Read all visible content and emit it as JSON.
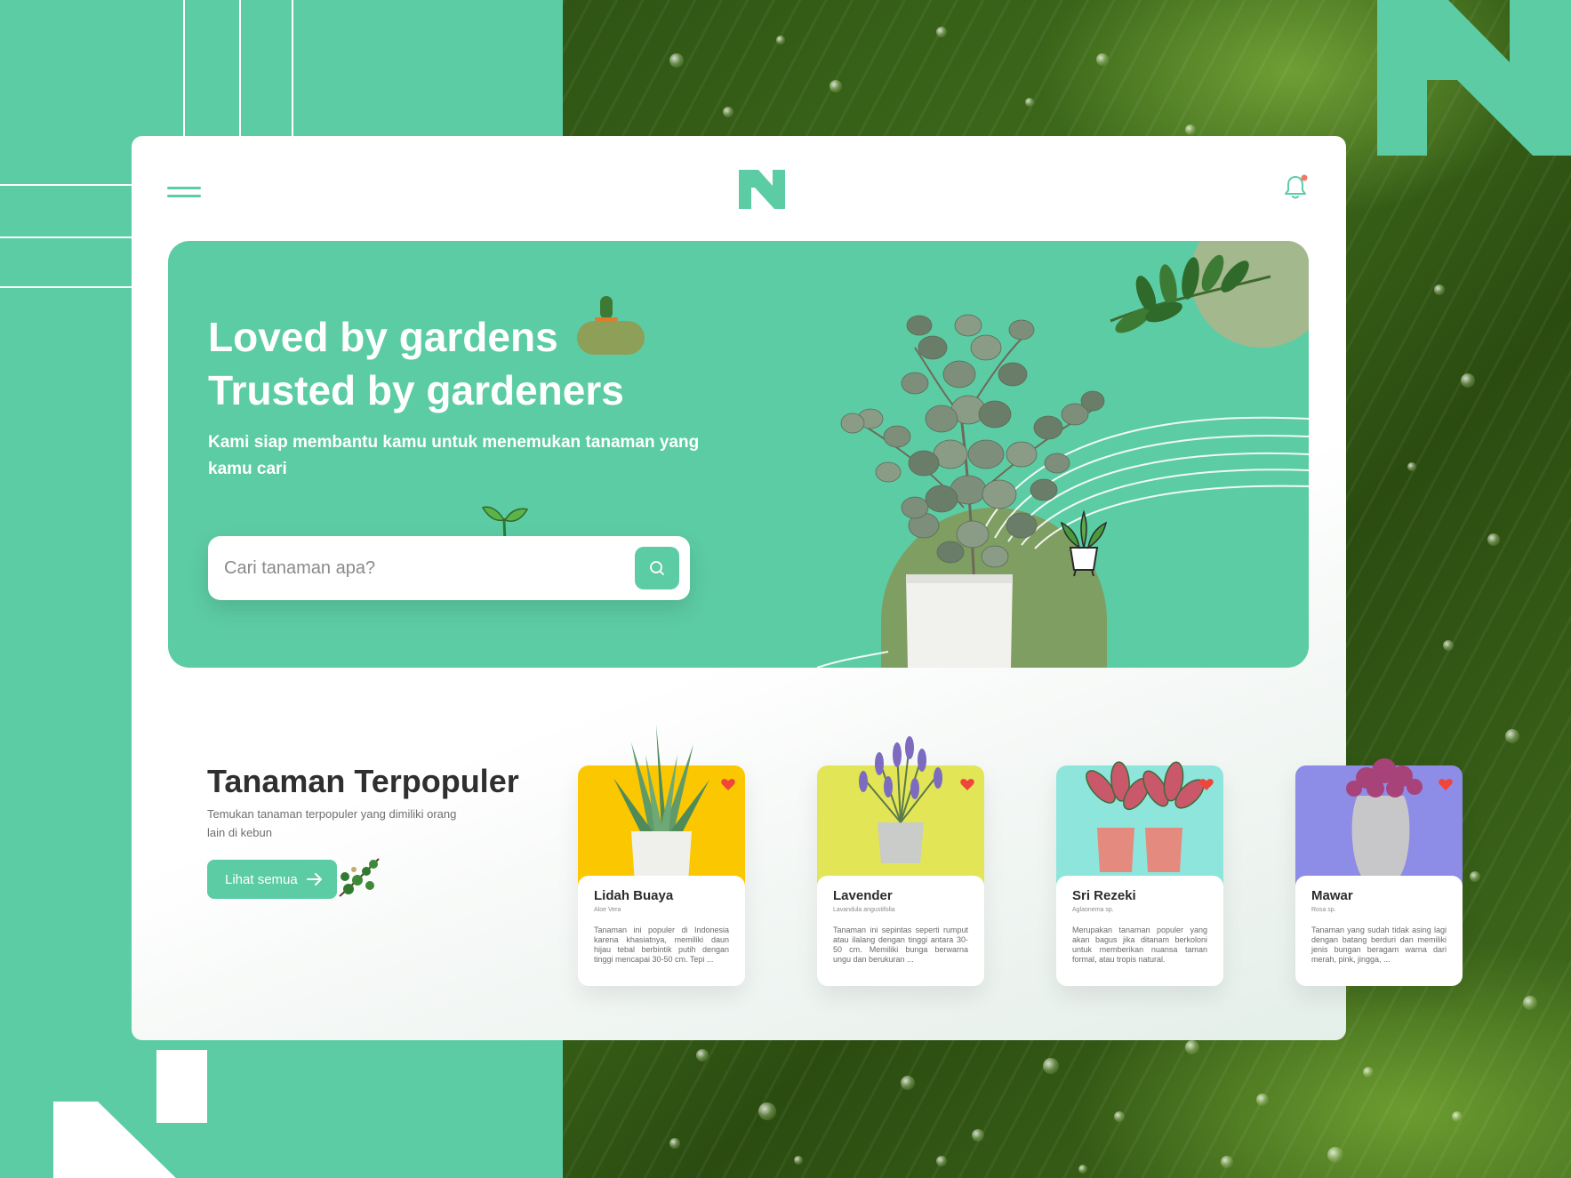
{
  "brand": {
    "accent": "#5ccca4",
    "logo_icon": "n-logo-icon"
  },
  "header": {
    "menu_icon": "hamburger-menu-icon",
    "notification_icon": "bell-icon",
    "notification_dot_color": "#f07a6a"
  },
  "hero": {
    "title_line1": "Loved by gardens",
    "title_line2": "Trusted by gardeners",
    "subtitle": "Kami siap membantu kamu untuk menemukan tanaman yang kamu cari",
    "search": {
      "placeholder": "Cari tanaman apa?",
      "value": "",
      "button_icon": "search-icon"
    }
  },
  "popular": {
    "title": "Tanaman Terpopuler",
    "subtitle": "Temukan tanaman terpopuler yang dimiliki orang lain di kebun",
    "see_all_label": "Lihat semua",
    "cards": [
      {
        "name": "Lidah Buaya",
        "latin": "Aloe Vera",
        "description": "Tanaman ini populer di Indonesia karena khasiatnya, memiliki daun hijau tebal berbintik putih dengan tinggi mencapai 30-50 cm. Tepi ...",
        "color": "#fbc700",
        "favorite": true
      },
      {
        "name": "Lavender",
        "latin": "Lavandula angustifolia",
        "description": "Tanaman ini sepintas seperti rumput atau ilalang dengan tinggi antara 30-50 cm. Memiliki bunga berwarna ungu dan berukuran ...",
        "color": "#e2e556",
        "favorite": true
      },
      {
        "name": "Sri Rezeki",
        "latin": "Aglaonema sp.",
        "description": "Merupakan tanaman populer yang akan bagus jika ditanam berkoloni untuk memberikan nuansa taman formal, atau tropis natural.",
        "color": "#8ee5dc",
        "favorite": true
      },
      {
        "name": "Mawar",
        "latin": "Rosa sp.",
        "description": "Tanaman yang sudah tidak asing lagi dengan batang berduri dan memiliki jenis bungan beragam warna dari merah, pink, jingga, ...",
        "color": "#8d8ce6",
        "favorite": true
      }
    ]
  }
}
